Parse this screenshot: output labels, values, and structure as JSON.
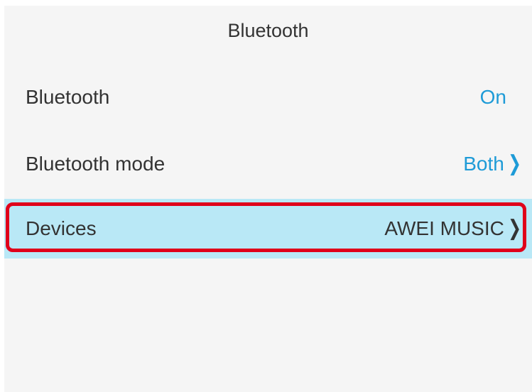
{
  "header": {
    "title": "Bluetooth"
  },
  "settings": [
    {
      "label": "Bluetooth",
      "value": "On"
    },
    {
      "label": "Bluetooth mode",
      "value": "Both"
    },
    {
      "label": "Devices",
      "value": "AWEI MUSIC"
    }
  ],
  "icons": {
    "chevron": "chevron-right-icon"
  },
  "colors": {
    "accent": "#1e9bd7",
    "selected_row": "#b9e8f6",
    "highlight_border": "#e0001a",
    "background": "#f5f5f5"
  }
}
